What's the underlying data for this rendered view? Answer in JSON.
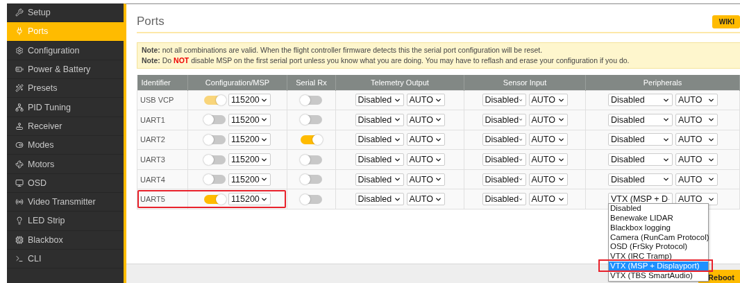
{
  "sidebar": {
    "items": [
      {
        "label": "Setup",
        "selected": false
      },
      {
        "label": "Ports",
        "selected": true
      },
      {
        "label": "Configuration",
        "selected": false
      },
      {
        "label": "Power & Battery",
        "selected": false
      },
      {
        "label": "Presets",
        "selected": false
      },
      {
        "label": "PID Tuning",
        "selected": false
      },
      {
        "label": "Receiver",
        "selected": false
      },
      {
        "label": "Modes",
        "selected": false
      },
      {
        "label": "Motors",
        "selected": false
      },
      {
        "label": "OSD",
        "selected": false
      },
      {
        "label": "Video Transmitter",
        "selected": false
      },
      {
        "label": "LED Strip",
        "selected": false
      },
      {
        "label": "Blackbox",
        "selected": false
      },
      {
        "label": "CLI",
        "selected": false
      }
    ]
  },
  "page": {
    "title": "Ports",
    "wiki_button": "WIKI"
  },
  "notes": [
    "**Note:** not all combinations are valid. When the flight controller firmware detects this the serial port configuration will be reset.",
    "**Note:** Do **NOT** disable MSP on the first serial port unless you know what you are doing. You may have to reflash and erase your configuration if you do."
  ],
  "table": {
    "columns": [
      "Identifier",
      "Configuration/MSP",
      "Serial Rx",
      "Telemetry Output",
      "Sensor Input",
      "Peripherals"
    ],
    "rows": [
      {
        "identifier": "USB VCP",
        "highlighted": false,
        "msp": {
          "on": true,
          "disabled": true,
          "baud": "115200"
        },
        "serial_rx": {
          "on": false
        },
        "telemetry": [
          "Disabled",
          "AUTO"
        ],
        "sensor": [
          "Disabled",
          "AUTO"
        ],
        "peripherals": [
          "Disabled",
          "AUTO"
        ]
      },
      {
        "identifier": "UART1",
        "highlighted": false,
        "msp": {
          "on": false,
          "disabled": false,
          "baud": "115200"
        },
        "serial_rx": {
          "on": false
        },
        "telemetry": [
          "Disabled",
          "AUTO"
        ],
        "sensor": [
          "Disabled",
          "AUTO"
        ],
        "peripherals": [
          "Disabled",
          "AUTO"
        ]
      },
      {
        "identifier": "UART2",
        "highlighted": false,
        "msp": {
          "on": false,
          "disabled": false,
          "baud": "115200"
        },
        "serial_rx": {
          "on": true
        },
        "telemetry": [
          "Disabled",
          "AUTO"
        ],
        "sensor": [
          "Disabled",
          "AUTO"
        ],
        "peripherals": [
          "Disabled",
          "AUTO"
        ]
      },
      {
        "identifier": "UART3",
        "highlighted": false,
        "msp": {
          "on": false,
          "disabled": false,
          "baud": "115200"
        },
        "serial_rx": {
          "on": false
        },
        "telemetry": [
          "Disabled",
          "AUTO"
        ],
        "sensor": [
          "Disabled",
          "AUTO"
        ],
        "peripherals": [
          "Disabled",
          "AUTO"
        ]
      },
      {
        "identifier": "UART4",
        "highlighted": false,
        "msp": {
          "on": false,
          "disabled": false,
          "baud": "115200"
        },
        "serial_rx": {
          "on": false
        },
        "telemetry": [
          "Disabled",
          "AUTO"
        ],
        "sensor": [
          "Disabled",
          "AUTO"
        ],
        "peripherals": [
          "Disabled",
          "AUTO"
        ]
      },
      {
        "identifier": "UART5",
        "highlighted": true,
        "msp": {
          "on": true,
          "disabled": false,
          "baud": "115200"
        },
        "serial_rx": {
          "on": false
        },
        "telemetry": [
          "Disabled",
          "AUTO"
        ],
        "sensor": [
          "Disabled",
          "AUTO"
        ],
        "peripherals": [
          "VTX (MSP + D",
          "AUTO"
        ],
        "open_list": [
          {
            "label": "Disabled",
            "selected": false,
            "highlighted": false
          },
          {
            "label": "Benewake LIDAR",
            "selected": false,
            "highlighted": false
          },
          {
            "label": "Blackbox logging",
            "selected": false,
            "highlighted": false
          },
          {
            "label": "Camera (RunCam Protocol)",
            "selected": false,
            "highlighted": false
          },
          {
            "label": "OSD (FrSky Protocol)",
            "selected": false,
            "highlighted": false
          },
          {
            "label": "VTX (IRC Tramp)",
            "selected": false,
            "highlighted": false
          },
          {
            "label": "VTX (MSP + Displayport)",
            "selected": true,
            "highlighted": true
          },
          {
            "label": "VTX (TBS SmartAudio)",
            "selected": false,
            "highlighted": false
          }
        ]
      }
    ]
  },
  "footer": {
    "reboot_button": "Reboot"
  }
}
